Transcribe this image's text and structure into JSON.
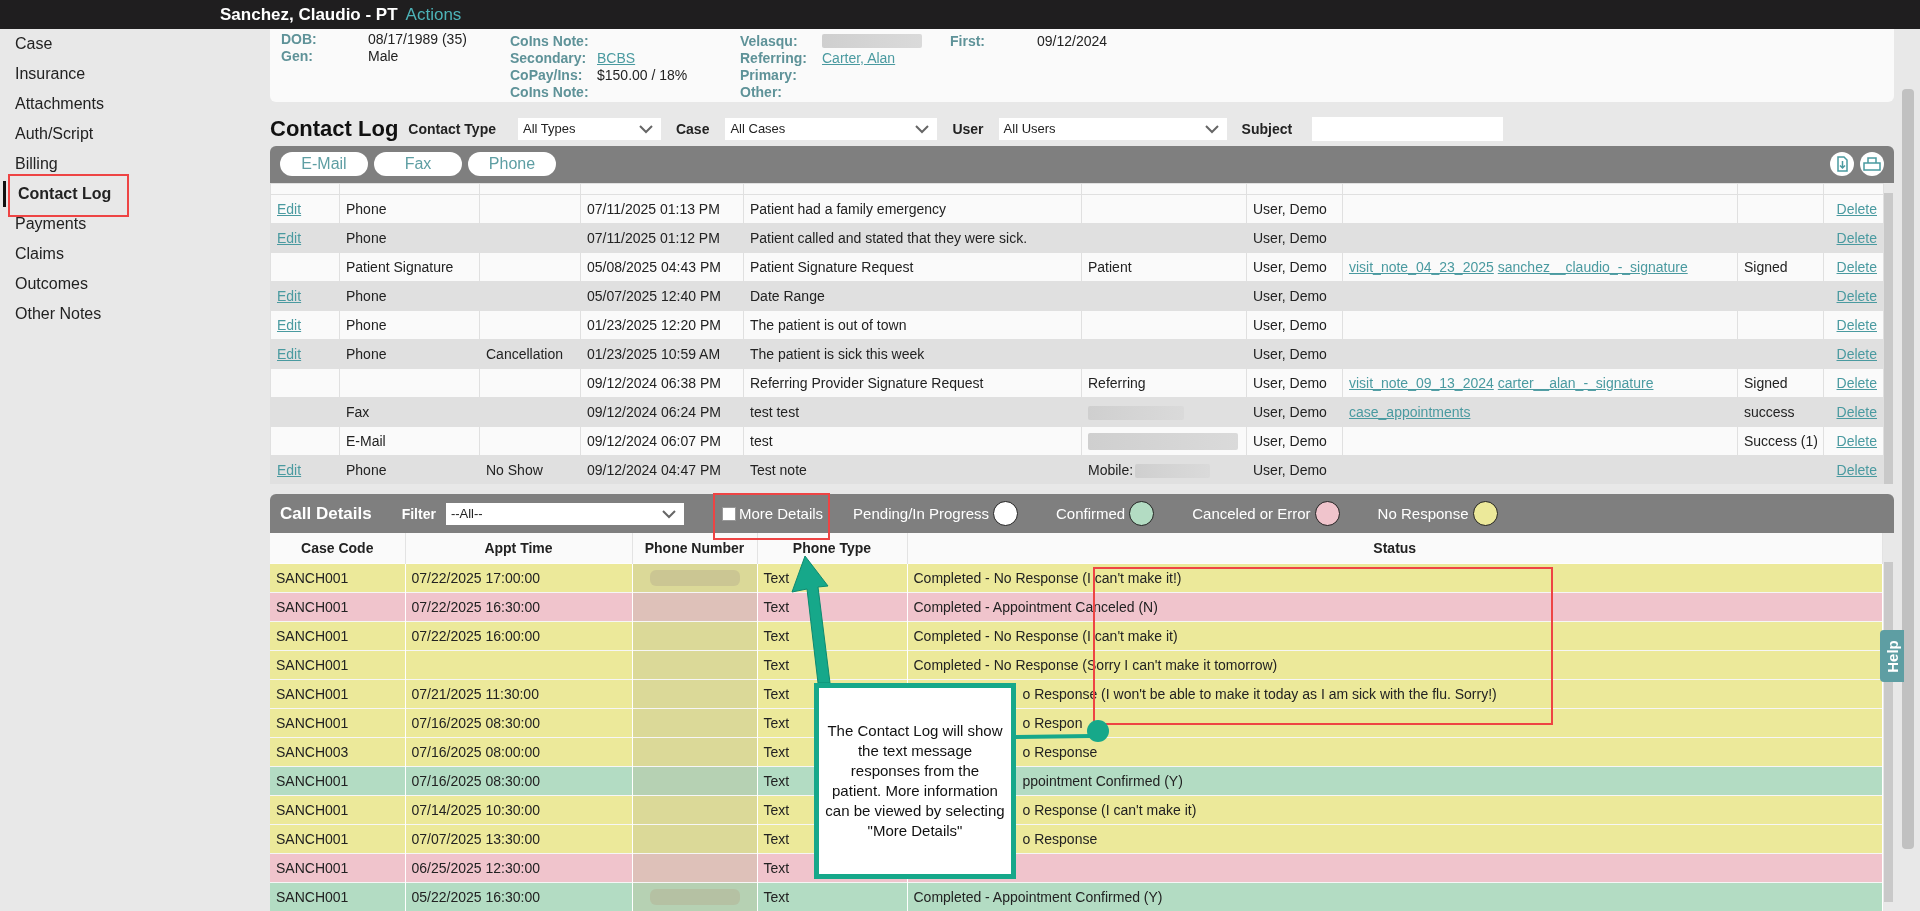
{
  "header": {
    "patient": "Sanchez, Claudio - PT",
    "actions": "Actions"
  },
  "sidebar": {
    "items": [
      {
        "label": "Case",
        "selected": false
      },
      {
        "label": "Insurance",
        "selected": false
      },
      {
        "label": "Attachments",
        "selected": false
      },
      {
        "label": "Auth/Script",
        "selected": false
      },
      {
        "label": "Billing",
        "selected": false
      },
      {
        "label": "Contact Log",
        "selected": true
      },
      {
        "label": "Payments",
        "selected": false
      },
      {
        "label": "Claims",
        "selected": false
      },
      {
        "label": "Outcomes",
        "selected": false
      },
      {
        "label": "Other Notes",
        "selected": false
      }
    ]
  },
  "patient_info": {
    "columns": [
      [
        {
          "label": "DOB:",
          "value": "08/17/1989 (35)",
          "kind": "text"
        },
        {
          "label": "Gen:",
          "value": "Male",
          "kind": "text"
        }
      ],
      [
        {
          "label": "CoIns Note:",
          "kind": "text"
        },
        {
          "label": "Secondary:",
          "value": "BCBS",
          "kind": "link"
        },
        {
          "label": "CoPay/Ins:",
          "value": "$150.00 / 18%",
          "kind": "text"
        },
        {
          "label": "CoIns Note:",
          "kind": "text"
        }
      ],
      [
        {
          "label": "Velasqu:",
          "kind": "redacted"
        },
        {
          "label": "Referring:",
          "value": "Carter, Alan",
          "kind": "link"
        },
        {
          "label": "Primary:",
          "kind": "text"
        },
        {
          "label": "Other:",
          "kind": "text"
        }
      ],
      [
        {
          "label": "First:",
          "value": "09/12/2024",
          "kind": "text"
        }
      ]
    ]
  },
  "contact_log": {
    "title": "Contact Log",
    "filters": [
      {
        "label": "Contact Type",
        "kind": "select",
        "value": "All Types"
      },
      {
        "label": "Case",
        "kind": "select",
        "value": "All Cases"
      },
      {
        "label": "User",
        "kind": "select",
        "value": "All Users"
      },
      {
        "label": "Subject",
        "kind": "input"
      }
    ],
    "type_buttons": [
      "E-Mail",
      "Fax",
      "Phone"
    ],
    "rows": [
      {
        "edit": "Edit",
        "type": "Phone",
        "date": "07/11/2025 01:13 PM",
        "subject": "Patient had a family emergency",
        "redacted": false,
        "user": "User, Demo",
        "delete": "Delete"
      },
      {
        "edit": "Edit",
        "type": "Phone",
        "date": "07/11/2025 01:12 PM",
        "subject": "Patient called and stated that they were sick.",
        "redacted": false,
        "user": "User, Demo",
        "delete": "Delete"
      },
      {
        "type": "Patient Signature",
        "date": "05/08/2025 04:43 PM",
        "subject": "Patient Signature Request",
        "recipient": "Patient",
        "redacted": false,
        "user": "User, Demo",
        "attachments": [
          "visit_note_04_23_2025",
          "sanchez__claudio_-_signature"
        ],
        "status": "Signed",
        "delete": "Delete"
      },
      {
        "edit": "Edit",
        "type": "Phone",
        "date": "05/07/2025 12:40 PM",
        "subject": "Date Range",
        "redacted": false,
        "user": "User, Demo",
        "delete": "Delete"
      },
      {
        "edit": "Edit",
        "type": "Phone",
        "date": "01/23/2025 12:20 PM",
        "subject": "The patient is out of town",
        "redacted": false,
        "user": "User, Demo",
        "delete": "Delete"
      },
      {
        "edit": "Edit",
        "type": "Phone",
        "reason": "Cancellation",
        "date": "01/23/2025 10:59 AM",
        "subject": "The patient is sick this week",
        "redacted": false,
        "user": "User, Demo",
        "delete": "Delete"
      },
      {
        "date": "09/12/2024 06:38 PM",
        "subject": "Referring Provider Signature Request",
        "recipient": "Referring",
        "redacted": false,
        "user": "User, Demo",
        "attachments": [
          "visit_note_09_13_2024",
          "carter__alan_-_signature"
        ],
        "status": "Signed",
        "delete": "Delete"
      },
      {
        "type": "Fax",
        "date": "09/12/2024 06:24 PM",
        "subject": "test test",
        "redacted": true,
        "user": "User, Demo",
        "attachments": [
          "case_appointments"
        ],
        "status": "success",
        "delete": "Delete"
      },
      {
        "type": "E-Mail",
        "date": "09/12/2024 06:07 PM",
        "subject": "test",
        "redacted": true,
        "user": "User, Demo",
        "status": "Success (1)",
        "delete": "Delete"
      },
      {
        "edit": "Edit",
        "type": "Phone",
        "reason": "No Show",
        "date": "09/12/2024 04:47 PM",
        "subject": "Test note",
        "recipient": "Mobile:",
        "redacted": true,
        "user": "User, Demo",
        "delete": "Delete"
      }
    ]
  },
  "call_details": {
    "title": "Call Details",
    "filter": {
      "label": "Filter",
      "value": "--All--"
    },
    "more_details": {
      "label": "More Details",
      "checked": false
    },
    "legend": [
      {
        "label": "Pending/In Progress",
        "color": "#ffffff"
      },
      {
        "label": "Confirmed",
        "color": "#b3dcc3"
      },
      {
        "label": "Canceled or Error",
        "color": "#f0c4cc"
      },
      {
        "label": "No Response",
        "color": "#ece99a"
      }
    ],
    "columns": [
      "Case Code",
      "Appt Time",
      "Phone Number",
      "Phone Type",
      "Status"
    ],
    "rows": [
      {
        "case_code": "SANCH001",
        "appt_time": "07/22/2025 17:00:00",
        "phone_type": "Text",
        "status": "Completed - No Response (I can't make it!)",
        "covered": false,
        "color": "#ece99a"
      },
      {
        "case_code": "SANCH001",
        "appt_time": "07/22/2025 16:30:00",
        "phone_type": "Text",
        "status": "Completed - Appointment Canceled (N)",
        "covered": false,
        "color": "#f0c4cc"
      },
      {
        "case_code": "SANCH001",
        "appt_time": "07/22/2025 16:00:00",
        "phone_type": "Text",
        "status": "Completed - No Response (I can't make it)",
        "covered": false,
        "color": "#ece99a"
      },
      {
        "case_code": "SANCH001",
        "phone_type": "Text",
        "status": "Completed - No Response (Sorry I can't make it tomorrow)",
        "covered": false,
        "color": "#ece99a"
      },
      {
        "case_code": "SANCH001",
        "appt_time": "07/21/2025 11:30:00",
        "phone_type": "Text",
        "status": "o Response (I won't be able to make it today as I am sick with the flu. Sorry!)",
        "covered": true,
        "color": "#ece99a"
      },
      {
        "case_code": "SANCH001",
        "appt_time": "07/16/2025 08:30:00",
        "phone_type": "Text",
        "status": "o Respon",
        "covered": true,
        "color": "#ece99a"
      },
      {
        "case_code": "SANCH003",
        "appt_time": "07/16/2025 08:00:00",
        "phone_type": "Text",
        "status": "o Response",
        "covered": true,
        "color": "#ece99a"
      },
      {
        "case_code": "SANCH001",
        "appt_time": "07/16/2025 08:30:00",
        "phone_type": "Text",
        "status": "ppointment Confirmed (Y)",
        "covered": true,
        "color": "#b3dcc3"
      },
      {
        "case_code": "SANCH001",
        "appt_time": "07/14/2025 10:30:00",
        "phone_type": "Text",
        "status": "o Response (I can't make it)",
        "covered": true,
        "color": "#ece99a"
      },
      {
        "case_code": "SANCH001",
        "appt_time": "07/07/2025 13:30:00",
        "phone_type": "Text",
        "status": "o Response",
        "covered": true,
        "color": "#ece99a"
      },
      {
        "case_code": "SANCH001",
        "appt_time": "06/25/2025 12:30:00",
        "phone_type": "Text",
        "color": "#f0c4cc"
      },
      {
        "case_code": "SANCH001",
        "appt_time": "05/22/2025 16:30:00",
        "phone_type": "Text",
        "status": "Completed - Appointment Confirmed (Y)",
        "covered": false,
        "color": "#b3dcc3"
      }
    ]
  },
  "help_tab": "Help",
  "annotation": {
    "callout": "The Contact Log will show the text message responses from the patient. More information can be viewed by selecting \"More Details\""
  }
}
